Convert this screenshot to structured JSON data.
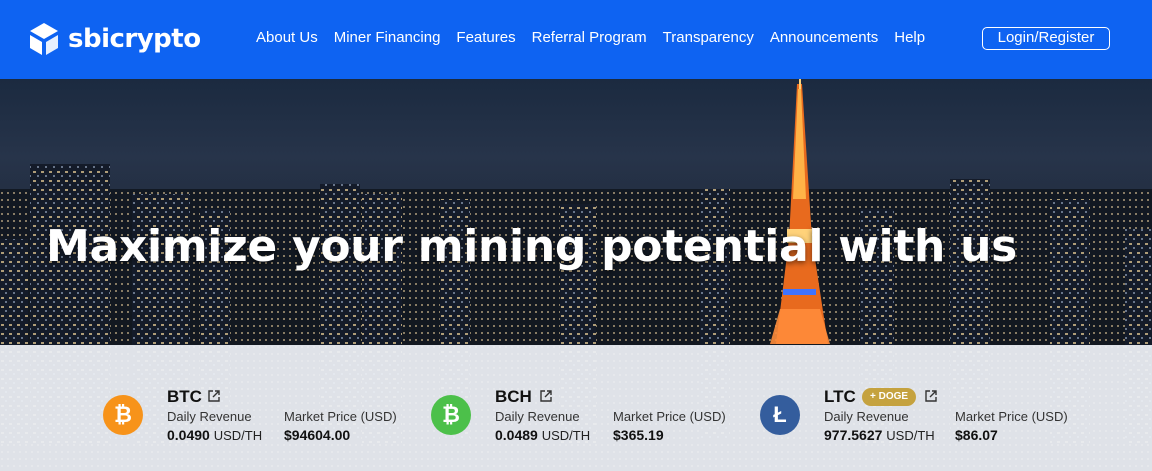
{
  "brand": {
    "name": "sbicrypto"
  },
  "nav": {
    "items": [
      "About Us",
      "Miner Financing",
      "Features",
      "Referral Program",
      "Transparency",
      "Announcements",
      "Help"
    ],
    "login_label": "Login/Register"
  },
  "hero": {
    "headline": "Maximize your mining potential with us"
  },
  "coins": [
    {
      "symbol": "BTC",
      "icon_char": "₿",
      "color": "#f7931a",
      "badge": "",
      "revenue_label": "Daily Revenue",
      "revenue_value": "0.0490",
      "revenue_unit": "USD/TH",
      "price_label": "Market Price (USD)",
      "price_value": "$94604.00"
    },
    {
      "symbol": "BCH",
      "icon_char": "₿",
      "color": "#4cc04a",
      "badge": "",
      "revenue_label": "Daily Revenue",
      "revenue_value": "0.0489",
      "revenue_unit": "USD/TH",
      "price_label": "Market Price (USD)",
      "price_value": "$365.19"
    },
    {
      "symbol": "LTC",
      "icon_char": "Ł",
      "color": "#345d9d",
      "badge": "+ DOGE",
      "revenue_label": "Daily Revenue",
      "revenue_value": "977.5627",
      "revenue_unit": "USD/TH",
      "price_label": "Market Price (USD)",
      "price_value": "$86.07"
    }
  ],
  "colors": {
    "nav_bg": "#0e63f2",
    "btc": "#f7931a",
    "bch": "#4cc04a",
    "ltc": "#345d9d",
    "doge_badge": "#c5a23f"
  },
  "icons": [
    "sbicrypto-logo-icon",
    "external-link-icon",
    "bitcoin-icon",
    "bitcoin-cash-icon",
    "litecoin-icon"
  ]
}
